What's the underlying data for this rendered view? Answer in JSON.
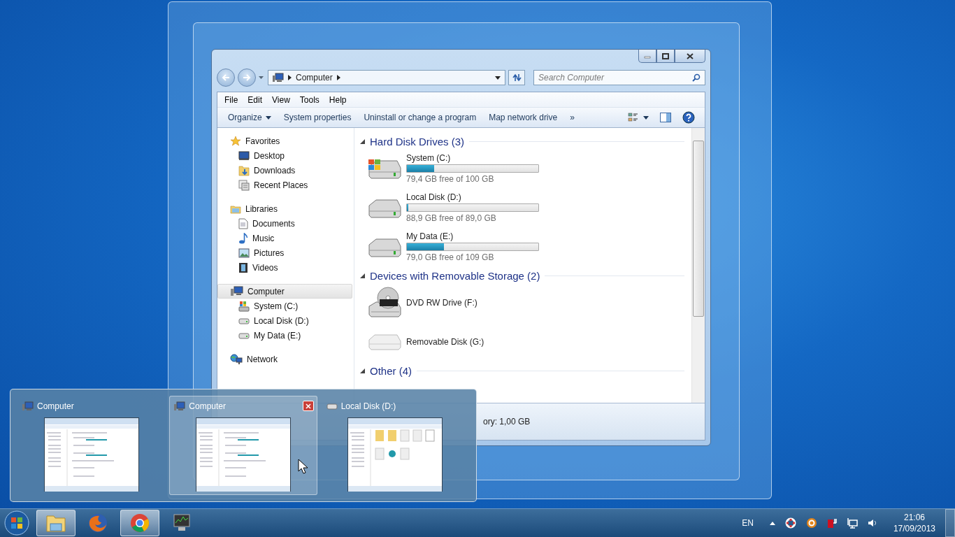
{
  "explorer": {
    "address": {
      "path": "Computer"
    },
    "search": {
      "placeholder": "Search Computer"
    },
    "menu": [
      "File",
      "Edit",
      "View",
      "Tools",
      "Help"
    ],
    "toolbar": [
      {
        "label": "Organize",
        "dropdown": true
      },
      {
        "label": "System properties",
        "dropdown": false
      },
      {
        "label": "Uninstall or change a program",
        "dropdown": false
      },
      {
        "label": "Map network drive",
        "dropdown": false
      },
      {
        "label": "»",
        "dropdown": false
      }
    ],
    "sidebar": [
      {
        "label": "Favorites",
        "kind": "star",
        "selected": false,
        "children": [
          {
            "label": "Desktop",
            "kind": "desktop",
            "selected": false
          },
          {
            "label": "Downloads",
            "kind": "folder",
            "selected": false
          },
          {
            "label": "Recent Places",
            "kind": "recent",
            "selected": false
          }
        ]
      },
      {
        "label": "Libraries",
        "kind": "library",
        "selected": false,
        "children": [
          {
            "label": "Documents",
            "kind": "document",
            "selected": false
          },
          {
            "label": "Music",
            "kind": "music",
            "selected": false
          },
          {
            "label": "Pictures",
            "kind": "picture",
            "selected": false
          },
          {
            "label": "Videos",
            "kind": "video",
            "selected": false
          }
        ]
      },
      {
        "label": "Computer",
        "kind": "computer",
        "selected": true,
        "children": [
          {
            "label": "System (C:)",
            "kind": "system",
            "selected": false
          },
          {
            "label": "Local Disk (D:)",
            "kind": "drive",
            "selected": false
          },
          {
            "label": "My Data (E:)",
            "kind": "drive",
            "selected": false
          }
        ]
      },
      {
        "label": "Network",
        "kind": "network",
        "selected": false
      }
    ],
    "sections": [
      {
        "title": "Hard Disk Drives (3)",
        "items": [
          {
            "name": "System (C:)",
            "kind": "system",
            "level": 0.21,
            "free": "79,4 GB free of 100 GB"
          },
          {
            "name": "Local Disk (D:)",
            "kind": "hdd",
            "level": 0.01,
            "free": "88,9 GB free of 89,0 GB"
          },
          {
            "name": "My Data (E:)",
            "kind": "hdd",
            "level": 0.28,
            "free": "79,0 GB free of 109 GB"
          }
        ]
      },
      {
        "title": "Devices with Removable Storage (2)",
        "items": [
          {
            "name": "DVD RW Drive (F:)",
            "kind": "dvd"
          },
          {
            "name": "Removable Disk (G:)",
            "kind": "removable"
          }
        ]
      },
      {
        "title": "Other (4)"
      }
    ],
    "status": "ory: 1,00 GB"
  },
  "switcher": [
    {
      "title": "Computer",
      "kind": "computer",
      "selected": false
    },
    {
      "title": "Computer",
      "kind": "computer",
      "selected": true
    },
    {
      "title": "Local Disk (D:)",
      "kind": "folder",
      "selected": false
    }
  ],
  "taskbar": [
    {
      "kind": "explorer",
      "highlighted": true
    },
    {
      "kind": "firefox",
      "highlighted": false
    },
    {
      "kind": "chrome",
      "highlighted": true
    },
    {
      "kind": "monitor",
      "highlighted": false
    }
  ],
  "tray": {
    "language": "EN",
    "time": "21:06",
    "date": "17/09/2013"
  }
}
